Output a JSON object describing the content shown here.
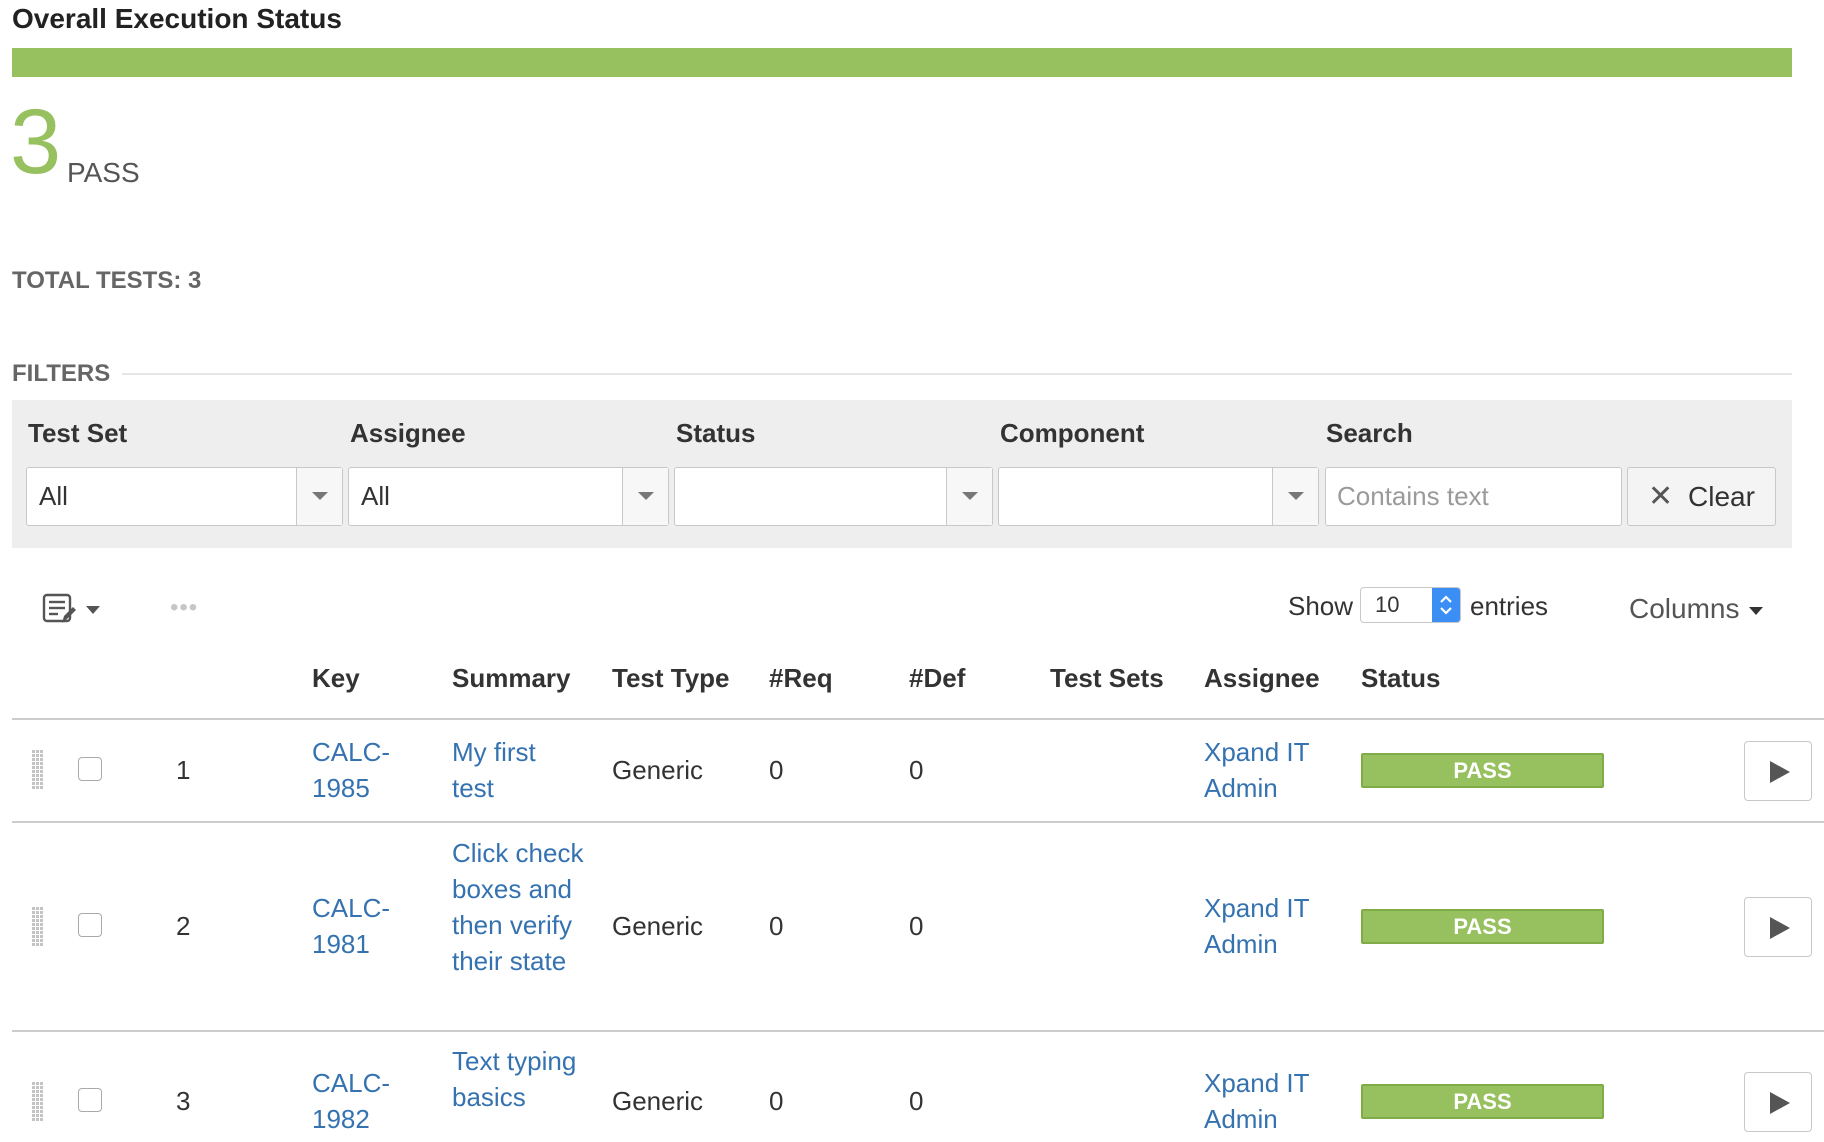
{
  "page": {
    "title": "Overall Execution Status",
    "status_count": "3",
    "status_label": "PASS",
    "total_tests": "TOTAL TESTS: 3"
  },
  "colors": {
    "pass": "#97c05e",
    "link": "#3572b0",
    "spinner": "#3b8ff4",
    "filter_panel": "#eeeeee"
  },
  "progress": {
    "pass_fraction": 1.0
  },
  "filters": {
    "heading": "FILTERS",
    "test_set": {
      "label": "Test Set",
      "value": "All"
    },
    "assignee": {
      "label": "Assignee",
      "value": "All"
    },
    "status": {
      "label": "Status",
      "value": ""
    },
    "component": {
      "label": "Component",
      "value": ""
    },
    "search": {
      "label": "Search",
      "placeholder": "Contains text",
      "value": ""
    },
    "clear_label": "Clear",
    "clear_icon": "close-icon",
    "dropdown_icon": "chevron-down-icon"
  },
  "toolbar": {
    "list_icon": "list-edit-icon",
    "more_icon": "more-horizontal-icon",
    "dots": "•••",
    "show_label": "Show",
    "entries_value": "10",
    "entries_label": "entries",
    "columns_label": "Columns"
  },
  "table": {
    "headers": {
      "key": "Key",
      "summary": "Summary",
      "test_type": "Test Type",
      "req": "#Req",
      "def": "#Def",
      "test_sets": "Test Sets",
      "assignee": "Assignee",
      "status": "Status"
    },
    "rows": [
      {
        "num": "1",
        "key": "CALC-1985",
        "summary": "My first test",
        "test_type": "Generic",
        "req": "0",
        "def": "0",
        "test_sets": "",
        "assignee": "Xpand IT Admin",
        "status": "PASS"
      },
      {
        "num": "2",
        "key": "CALC-1981",
        "summary": "Click check boxes and then verify their state",
        "test_type": "Generic",
        "req": "0",
        "def": "0",
        "test_sets": "",
        "assignee": "Xpand IT Admin",
        "status": "PASS"
      },
      {
        "num": "3",
        "key": "CALC-1982",
        "summary": "Text typing basics",
        "test_type": "Generic",
        "req": "0",
        "def": "0",
        "test_sets": "",
        "assignee": "Xpand IT Admin",
        "status": "PASS"
      }
    ]
  }
}
